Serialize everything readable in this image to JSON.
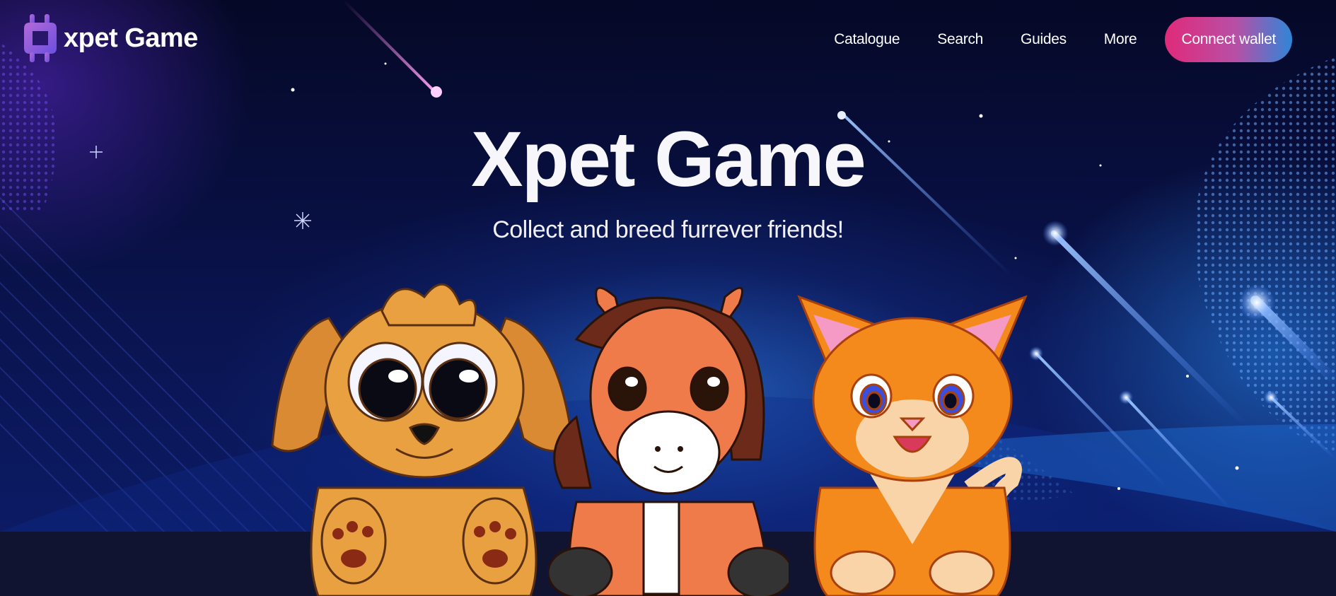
{
  "brand": {
    "logo_text": "xpet Game",
    "logo_icon": "xpet-logo-icon"
  },
  "nav": {
    "links": [
      "Catalogue",
      "Search",
      "Guides",
      "More"
    ],
    "cta": "Connect wallet"
  },
  "hero": {
    "title": "Xpet Game",
    "subtitle": "Collect and breed furrever friends!",
    "pets": [
      "puppy",
      "pony",
      "kitten"
    ]
  },
  "colors": {
    "background": "#050826",
    "cta_start": "#e02a7a",
    "cta_end": "#2f86d8",
    "logo_accent": "#8a5ce6"
  }
}
